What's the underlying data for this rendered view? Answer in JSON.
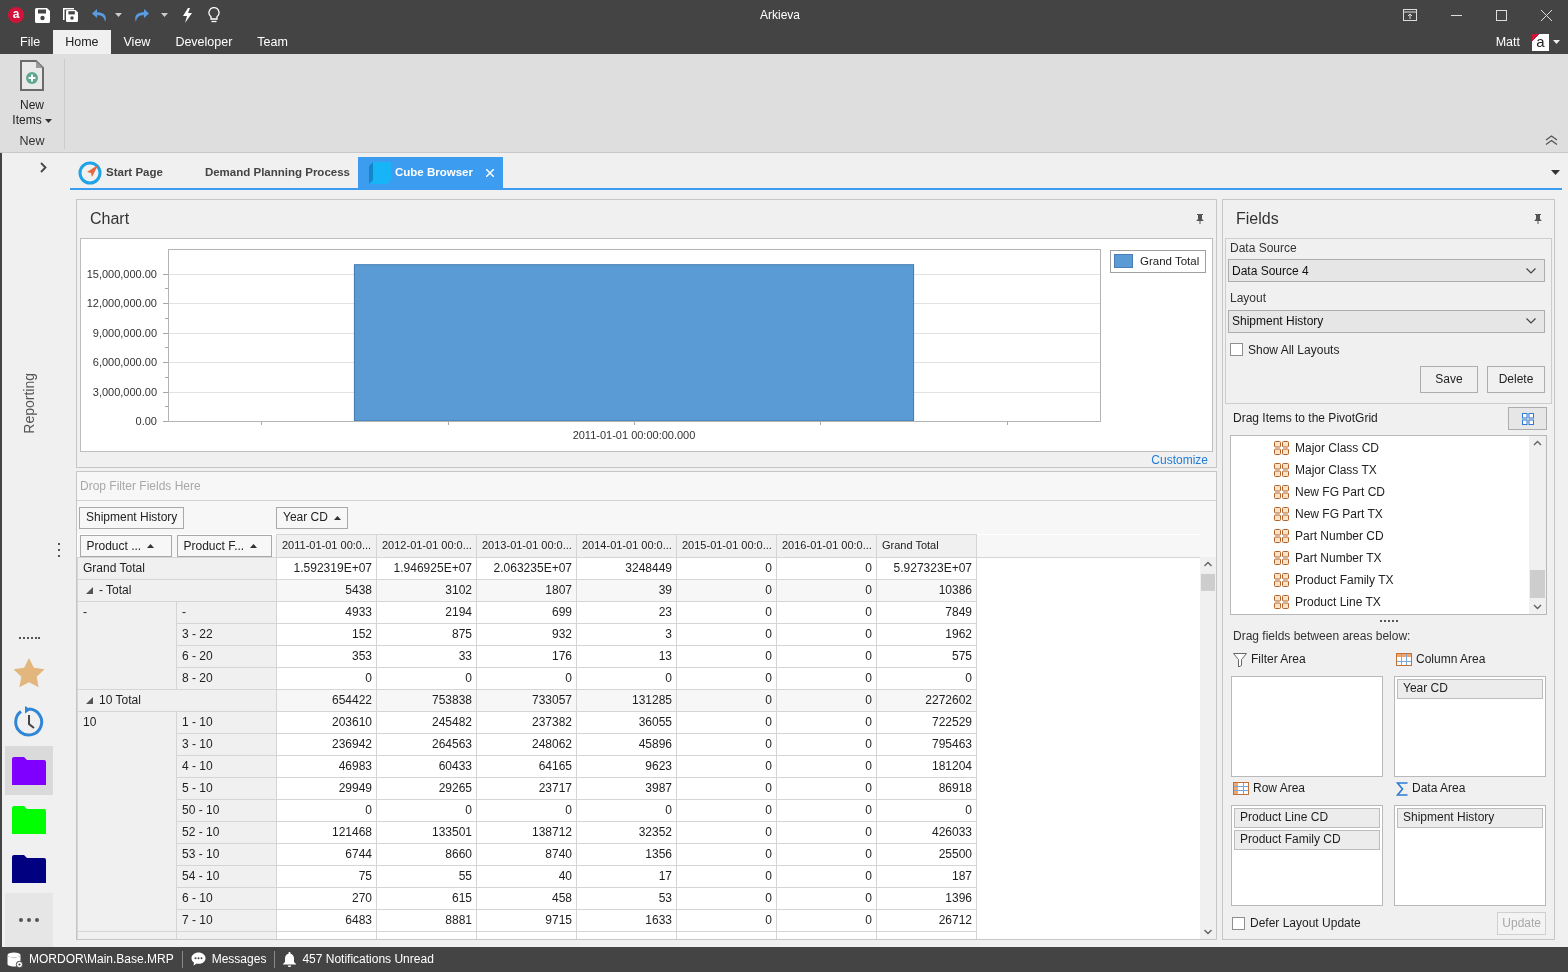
{
  "title_bar": {
    "logo": "a",
    "title": "Arkieva"
  },
  "menu_tabs": [
    {
      "label": "File",
      "selected": false
    },
    {
      "label": "Home",
      "selected": true
    },
    {
      "label": "View",
      "selected": false
    },
    {
      "label": "Developer",
      "selected": false
    },
    {
      "label": "Team",
      "selected": false
    }
  ],
  "user": {
    "name": "Matt",
    "avatar": "a"
  },
  "ribbon": {
    "groups": [
      {
        "label": "New",
        "buttons": [
          {
            "label": "New Items",
            "dropdown": true
          }
        ]
      }
    ]
  },
  "sidebar": {
    "label": "Reporting",
    "items": [
      {
        "kind": "favorites",
        "selected": false
      },
      {
        "kind": "history",
        "selected": false
      },
      {
        "kind": "folder",
        "color": "#8000ff",
        "selected": true
      },
      {
        "kind": "folder",
        "color": "#00ff00",
        "selected": false
      },
      {
        "kind": "folder",
        "color": "#000080",
        "selected": false
      }
    ]
  },
  "doc_tabs": [
    {
      "kind": "start",
      "label": "Start Page",
      "selected": false
    },
    {
      "kind": "plain",
      "label": "Demand Planning Process",
      "selected": false
    },
    {
      "kind": "cube",
      "label": "Cube Browser",
      "selected": true
    }
  ],
  "chart_panel": {
    "title": "Chart",
    "link": "Customize",
    "chart_data": [
      {
        "type": "bar",
        "categories": [
          "2011-01-01 00:00:00.000"
        ],
        "series": [
          {
            "name": "Grand Total",
            "color": "#5b9bd5",
            "values": [
              15900000
            ]
          }
        ],
        "ylim": [
          0,
          17500000
        ],
        "yticks": [
          {
            "value": 0,
            "label": "0.00"
          },
          {
            "value": 3000000,
            "label": "3,000,000.00"
          },
          {
            "value": 6000000,
            "label": "6,000,000.00"
          },
          {
            "value": 9000000,
            "label": "9,000,000.00"
          },
          {
            "value": 12000000,
            "label": "12,000,000.00"
          },
          {
            "value": 15000000,
            "label": "15,000,000.00"
          }
        ],
        "legend": "right",
        "grid": true
      }
    ]
  },
  "pivot": {
    "filter_hint": "Drop Filter Fields Here",
    "data_fields": [
      {
        "label": "Shipment History"
      }
    ],
    "column_fields": [
      {
        "label": "Year CD",
        "sort_ascending": true
      }
    ],
    "row_fields": [
      {
        "label": "Product ...",
        "sort_ascending": true
      },
      {
        "label": "Product F...",
        "sort_ascending": true
      }
    ],
    "columns": [
      "2011-01-01 00:0...",
      "2012-01-01 00:0...",
      "2013-01-01 00:0...",
      "2014-01-01 00:0...",
      "2015-01-01 00:0...",
      "2016-01-01 00:0...",
      "Grand Total"
    ],
    "grand_total": {
      "label": "Grand Total",
      "values": [
        "1.592319E+07",
        "1.946925E+07",
        "2.063235E+07",
        "3248449",
        "0",
        "0",
        "5.927323E+07"
      ]
    },
    "groups": [
      {
        "total_label": "- Total",
        "expanded": true,
        "total_values": [
          "5438",
          "3102",
          "1807",
          "39",
          "0",
          "0",
          "10386"
        ],
        "label": "-",
        "children": [
          {
            "label": "-",
            "values": [
              "4933",
              "2194",
              "699",
              "23",
              "0",
              "0",
              "7849"
            ]
          },
          {
            "label": "3 - 22",
            "values": [
              "152",
              "875",
              "932",
              "3",
              "0",
              "0",
              "1962"
            ]
          },
          {
            "label": "6 - 20",
            "values": [
              "353",
              "33",
              "176",
              "13",
              "0",
              "0",
              "575"
            ]
          },
          {
            "label": "8 - 20",
            "values": [
              "0",
              "0",
              "0",
              "0",
              "0",
              "0",
              "0"
            ]
          }
        ]
      },
      {
        "total_label": "10 Total",
        "expanded": true,
        "total_values": [
          "654422",
          "753838",
          "733057",
          "131285",
          "0",
          "0",
          "2272602"
        ],
        "label": "10",
        "children": [
          {
            "label": "1 - 10",
            "values": [
              "203610",
              "245482",
              "237382",
              "36055",
              "0",
              "0",
              "722529"
            ]
          },
          {
            "label": "3 - 10",
            "values": [
              "236942",
              "264563",
              "248062",
              "45896",
              "0",
              "0",
              "795463"
            ]
          },
          {
            "label": "4 - 10",
            "values": [
              "46983",
              "60433",
              "64165",
              "9623",
              "0",
              "0",
              "181204"
            ]
          },
          {
            "label": "5 - 10",
            "values": [
              "29949",
              "29265",
              "23717",
              "3987",
              "0",
              "0",
              "86918"
            ]
          },
          {
            "label": "50 - 10",
            "values": [
              "0",
              "0",
              "0",
              "0",
              "0",
              "0",
              "0"
            ]
          },
          {
            "label": "52 - 10",
            "values": [
              "121468",
              "133501",
              "138712",
              "32352",
              "0",
              "0",
              "426033"
            ]
          },
          {
            "label": "53 - 10",
            "values": [
              "6744",
              "8660",
              "8740",
              "1356",
              "0",
              "0",
              "25500"
            ]
          },
          {
            "label": "54 - 10",
            "values": [
              "75",
              "55",
              "40",
              "17",
              "0",
              "0",
              "187"
            ]
          },
          {
            "label": "6 - 10",
            "values": [
              "270",
              "615",
              "458",
              "53",
              "0",
              "0",
              "1396"
            ]
          },
          {
            "label": "7 - 10",
            "values": [
              "6483",
              "8881",
              "9715",
              "1633",
              "0",
              "0",
              "26712"
            ]
          }
        ]
      }
    ]
  },
  "fields_panel": {
    "title": "Fields",
    "data_source": {
      "label": "Data Source",
      "value": "Data Source 4"
    },
    "layout": {
      "label": "Layout",
      "value": "Shipment History"
    },
    "show_all_layouts": {
      "label": "Show All Layouts",
      "checked": false
    },
    "buttons": [
      {
        "label": "Save",
        "disabled": false
      },
      {
        "label": "Delete",
        "disabled": false
      }
    ],
    "field_list": {
      "label": "Drag Items to the PivotGrid",
      "items": [
        "Major Class CD",
        "Major Class TX",
        "New FG Part CD",
        "New FG Part TX",
        "Part Number CD",
        "Part Number TX",
        "Product Family TX",
        "Product Line TX"
      ]
    },
    "areas_hint": "Drag fields between areas below:",
    "areas": [
      {
        "kind": "filter",
        "label": "Filter Area"
      },
      {
        "kind": "column",
        "label": "Column Area",
        "fields": [
          "Year CD"
        ]
      },
      {
        "kind": "row",
        "label": "Row Area",
        "fields": [
          "Product Line CD",
          "Product Family CD"
        ]
      },
      {
        "kind": "data",
        "label": "Data Area",
        "fields": [
          "Shipment History"
        ]
      }
    ],
    "defer_update": {
      "label": "Defer Layout Update",
      "checked": false
    },
    "update_button": {
      "label": "Update",
      "disabled": true
    }
  },
  "status_bar": {
    "items": [
      {
        "kind": "database",
        "label": "MORDOR\\Main.Base.MRP"
      },
      {
        "kind": "messages",
        "label": "Messages"
      },
      {
        "kind": "notifications",
        "label": "457 Notifications Unread"
      }
    ]
  }
}
